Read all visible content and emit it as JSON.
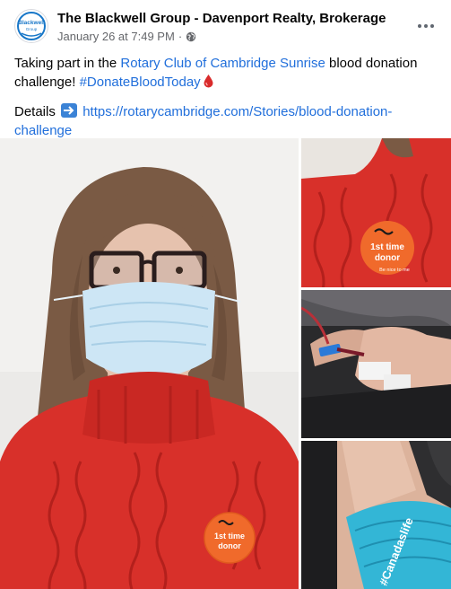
{
  "post": {
    "page_name": "The Blackwell Group - Davenport Realty, Brokerage",
    "avatar_text": "Blackwell",
    "avatar_sub": "Group",
    "date": "January 26 at 7:49 PM",
    "separator": "·",
    "more_label": "•••",
    "text_intro": "Taking part in the ",
    "text_link": "Rotary Club of Cambridge Sunrise",
    "text_mid": " blood donation challenge! ",
    "hashtag": "#DonateBloodToday",
    "details_label": "Details",
    "details_url": "https://rotarycambridge.com/Stories/blood-donation-challenge"
  },
  "photos": {
    "sticker_line1": "1st time",
    "sticker_line2": "donor",
    "sticker_line3": "Be nice to me",
    "bandage_text": "#Canadaslife"
  },
  "colors": {
    "link": "#216fdb",
    "sweater": "#d8302a",
    "sticker": "#f06a2b",
    "bandage": "#33b6d6"
  },
  "icons": [
    "globe-icon",
    "more-icon",
    "blood-drop-icon",
    "right-arrow-icon"
  ]
}
